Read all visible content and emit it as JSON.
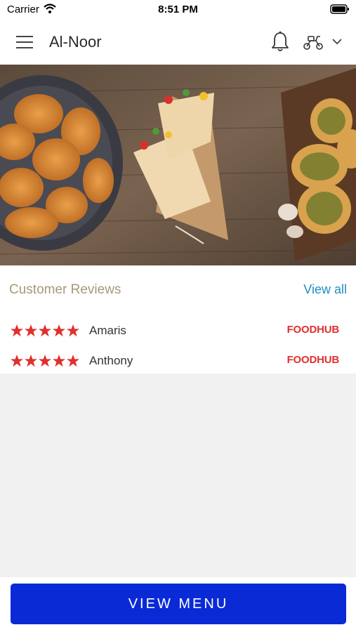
{
  "status_bar": {
    "carrier": "Carrier",
    "time": "8:51 PM"
  },
  "header": {
    "title": "Al-Noor",
    "icons": [
      "menu-icon",
      "bell-icon",
      "scooter-icon",
      "chevron-down-icon"
    ]
  },
  "hero": {
    "image": "food-banner",
    "dishes": [
      "fried chicken",
      "chicken wraps",
      "garlic bread"
    ]
  },
  "reviews": {
    "title": "Customer Reviews",
    "view_all": "View all",
    "items": [
      {
        "name": "Amaris",
        "rating": 5,
        "source": "FOODHUB"
      },
      {
        "name": "Anthony",
        "rating": 5,
        "source": "FOODHUB"
      }
    ]
  },
  "footer": {
    "button_label": "VIEW MENU"
  },
  "colors": {
    "accent": "#0a2ad6",
    "star": "#e0302d",
    "link": "#1f8fc0",
    "section_title": "#a8987a"
  }
}
